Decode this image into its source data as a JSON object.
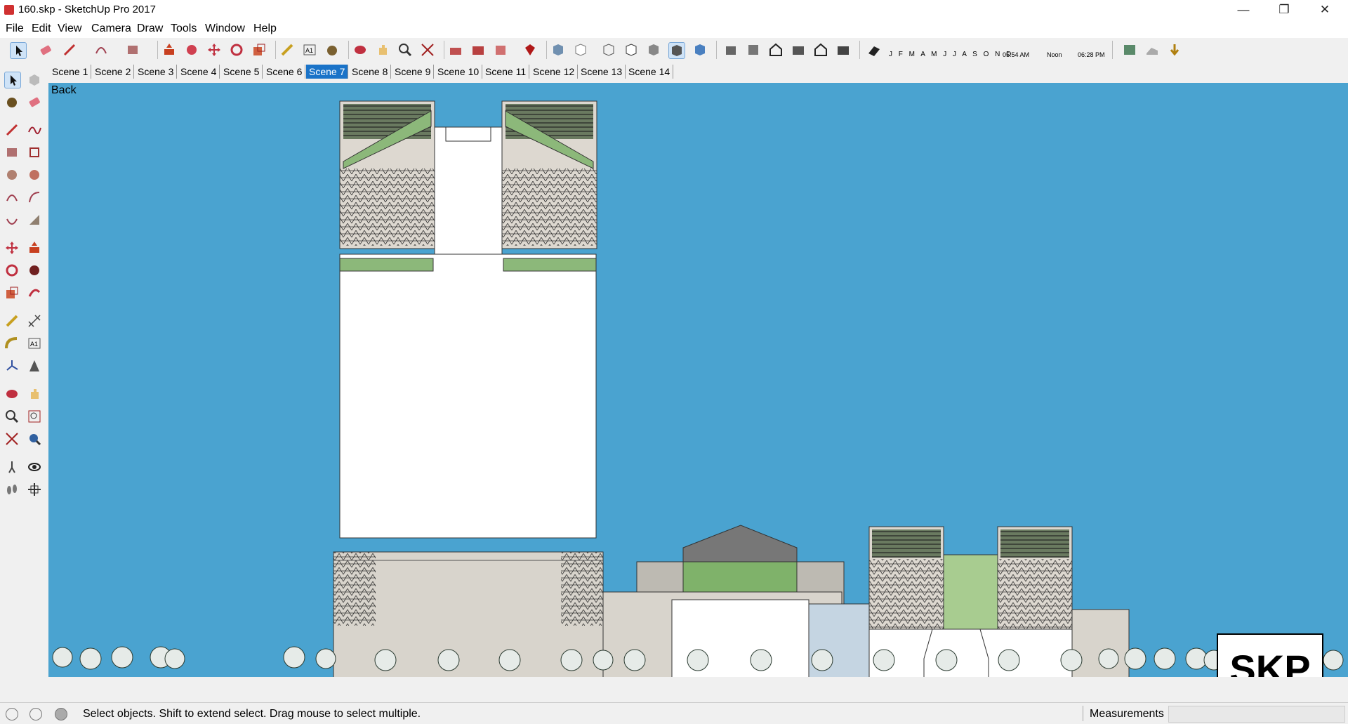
{
  "window": {
    "title": "160.skp - SketchUp Pro 2017"
  },
  "menu": [
    "File",
    "Edit",
    "View",
    "Camera",
    "Draw",
    "Tools",
    "Window",
    "Help"
  ],
  "shadow_panel": {
    "months": "J F M A M J J A S O N D",
    "time_start": "05:54 AM",
    "time_mid": "Noon",
    "time_end": "06:28 PM"
  },
  "scenes": [
    "Scene 1",
    "Scene 2",
    "Scene 3",
    "Scene 4",
    "Scene 5",
    "Scene 6",
    "Scene 7",
    "Scene 8",
    "Scene 9",
    "Scene 10",
    "Scene 11",
    "Scene 12",
    "Scene 13",
    "Scene 14"
  ],
  "active_scene": "Scene 7",
  "viewport": {
    "view_name": "Back",
    "watermark": "SKP"
  },
  "status": {
    "message": "Select objects. Shift to extend select. Drag mouse to select multiple.",
    "measurements_label": "Measurements",
    "measurements_value": ""
  },
  "colors": {
    "sky": "#4aa3d0",
    "active_tab": "#1a73c8",
    "green_glass": "#8cb87a",
    "concrete": "#d8d4cc"
  }
}
